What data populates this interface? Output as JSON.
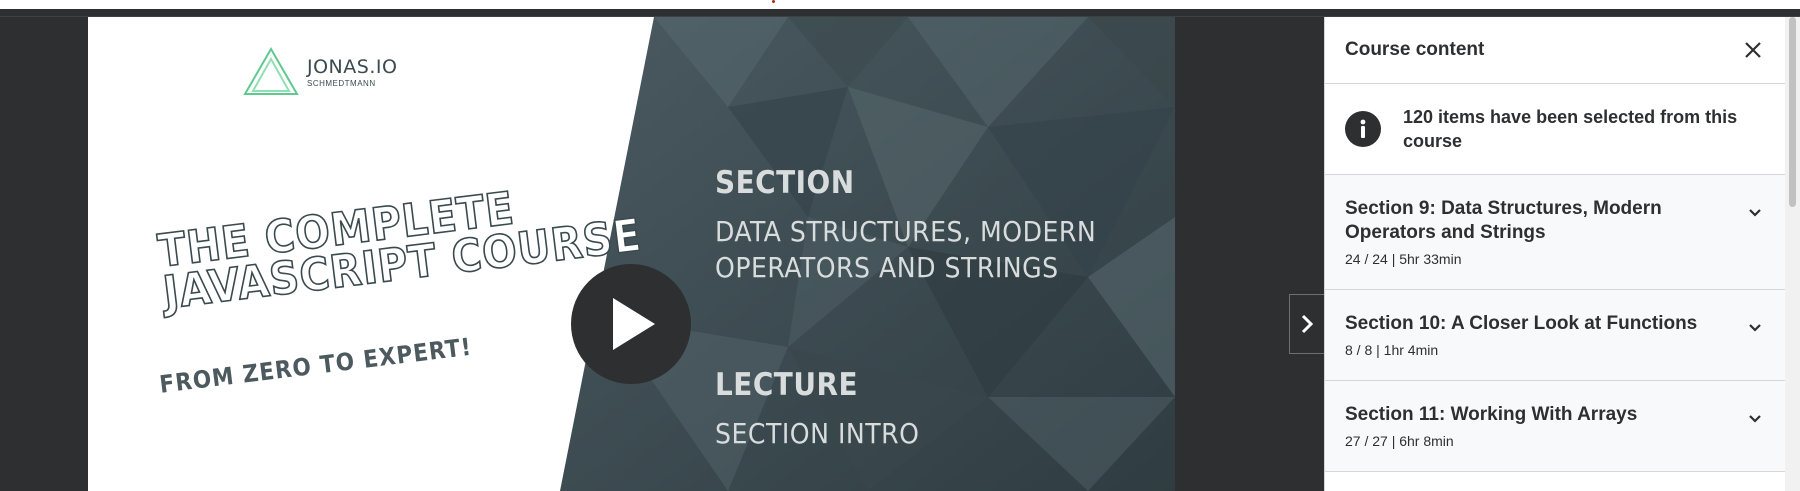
{
  "slide": {
    "brand_name": "JONAS.IO",
    "brand_sub": "SCHMEDTMANN",
    "course_title_line1": "THE COMPLETE",
    "course_title_line2": "JAVASCRIPT COURSE",
    "course_subtitle": "FROM ZERO TO EXPERT!",
    "section_heading": "SECTION",
    "section_line1": "DATA STRUCTURES, MODERN",
    "section_line2": "OPERATORS AND STRINGS",
    "lecture_heading": "LECTURE",
    "lecture_title": "SECTION INTRO"
  },
  "sidebar": {
    "title": "Course content",
    "notice": "120 items have been selected from this course",
    "sections": [
      {
        "name": "Section 9: Data Structures, Modern Operators and Strings",
        "meta": "24 / 24 | 5hr 33min"
      },
      {
        "name": "Section 10: A Closer Look at Functions",
        "meta": "8 / 8 | 1hr 4min"
      },
      {
        "name": "Section 11: Working With Arrays",
        "meta": "27 / 27 | 6hr 8min"
      }
    ]
  },
  "icons": {
    "play": "play-icon",
    "expand": "chevron-right-icon",
    "close": "close-icon",
    "info": "info-icon",
    "chevron": "chevron-down-icon"
  }
}
